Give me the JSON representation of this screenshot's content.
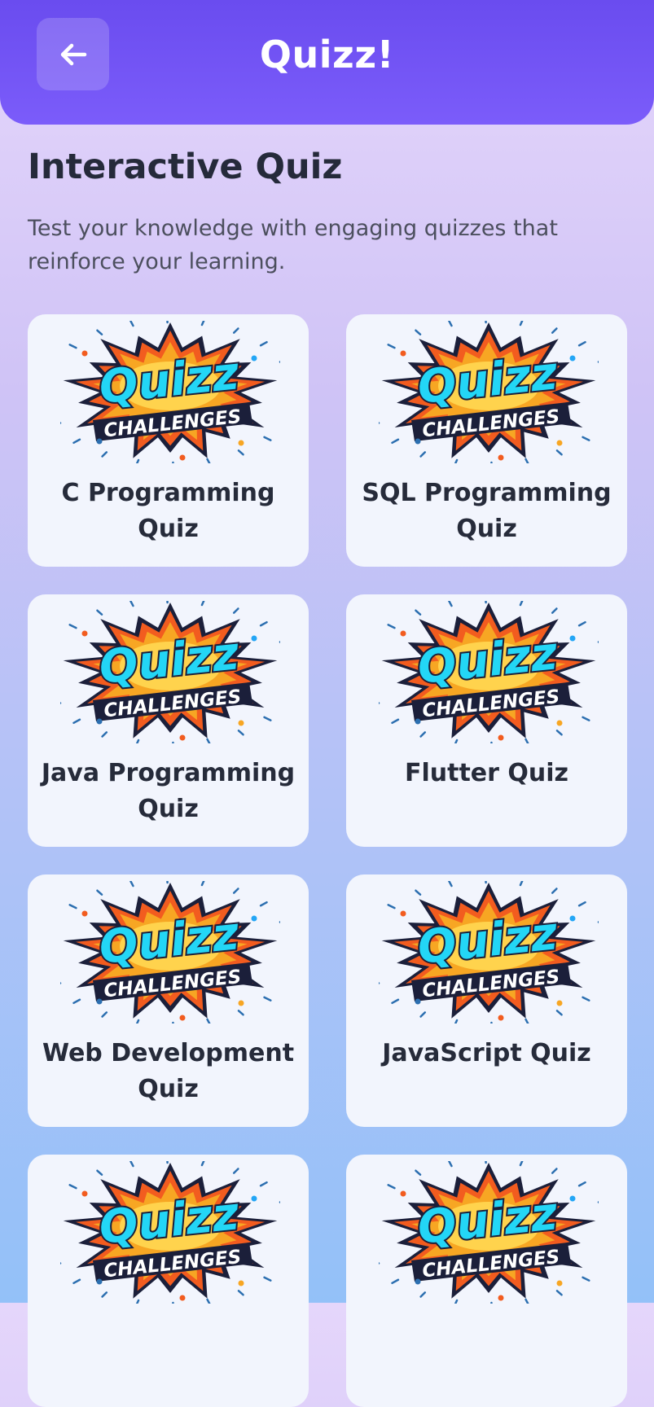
{
  "header": {
    "title": "Quizz!",
    "back_icon": "arrow-left-icon"
  },
  "section": {
    "title": "Interactive Quiz",
    "description": "Test your knowledge with engaging quizzes that reinforce your learning."
  },
  "logo": {
    "word": "Quizz",
    "subtitle": "CHALLENGES"
  },
  "quizzes": [
    {
      "title": "C Programming Quiz"
    },
    {
      "title": "SQL Programming Quiz"
    },
    {
      "title": "Java Programming Quiz"
    },
    {
      "title": "Flutter Quiz"
    },
    {
      "title": "Web Development Quiz"
    },
    {
      "title": "JavaScript Quiz"
    },
    {
      "title": ""
    },
    {
      "title": ""
    }
  ],
  "colors": {
    "header": "#7b5cfa",
    "logo_text": "#23d6f6",
    "logo_burst": "#f7a623",
    "card": "#f2f5fd"
  }
}
